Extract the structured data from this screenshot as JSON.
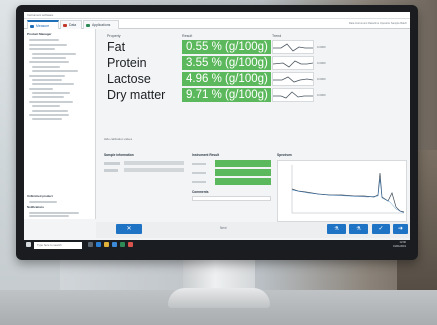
{
  "window": {
    "title": "Instrument software",
    "user_info": "Data Instrument   Date/time   Operator   Sample   Batch"
  },
  "tabs": [
    {
      "label": "Measure",
      "icon": "flask-icon",
      "color": "#1e6fb8"
    },
    {
      "label": "Data",
      "icon": "table-icon",
      "color": "#c0392b"
    },
    {
      "label": "Applications",
      "icon": "apps-icon",
      "color": "#2e8b57"
    }
  ],
  "sidebar": {
    "title": "Product Manager",
    "footer_a": "Unfinished product",
    "footer_b": "Notifications"
  },
  "results": {
    "headers": {
      "property": "Property",
      "result": "Result",
      "trend": "Trend"
    },
    "rows": [
      {
        "property": "Fat",
        "value": "0.55 % (g/100g)",
        "trend_unit": "0.0000"
      },
      {
        "property": "Protein",
        "value": "3.55 % (g/100g)",
        "trend_unit": "0.0000"
      },
      {
        "property": "Lactose",
        "value": "4.96 % (g/100g)",
        "trend_unit": "0.0000"
      },
      {
        "property": "Dry matter",
        "value": "9.71 % (g/100g)",
        "trend_unit": "0.0000"
      }
    ],
    "hint": "Hide calibration values"
  },
  "panels": {
    "sample_info": "Sample information",
    "instrument": "Instrument Result",
    "spectrum": "Spectrum",
    "comments": "Comments"
  },
  "actions": {
    "cancel": "✕",
    "mid": "Next",
    "confirm": "✓",
    "next": "➜"
  },
  "taskbar": {
    "search_placeholder": "Type here to search",
    "time": "12:00",
    "date": "01/01/2019"
  },
  "colors": {
    "result_green": "#5cb85c",
    "accent_blue": "#1f73c4"
  }
}
